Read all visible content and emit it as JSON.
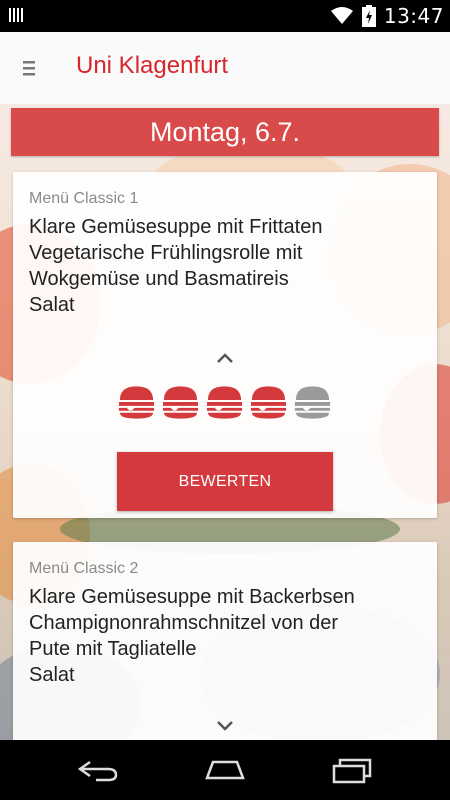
{
  "status_bar": {
    "time": "13:47",
    "icons": [
      "signal-bars-icon",
      "wifi-icon",
      "battery-icon"
    ]
  },
  "app_bar": {
    "title": "Uni Klagenfurt",
    "menu_icon": "hamburger-menu-icon"
  },
  "day_banner": {
    "label": "Montag, 6.7."
  },
  "menus": [
    {
      "label": "Menü Classic 1",
      "dishes": [
        "Klare Gemüsesuppe mit Frittaten",
        "Vegetarische Frühlingsrolle mit",
        "Wokgemüse und Basmatireis",
        "Salat"
      ],
      "rating": 4,
      "rating_max": 5,
      "rate_button": "BEWERTEN",
      "expanded": true
    },
    {
      "label": "Menü Classic 2",
      "dishes": [
        "Klare Gemüsesuppe mit Backerbsen",
        "Champignonrahmschnitzel von der",
        "Pute mit Tagliatelle",
        "Salat"
      ],
      "expanded": false
    }
  ],
  "colors": {
    "accent": "#d7262c",
    "banner": "#d94a4a",
    "button": "#d43a3d",
    "burger_active": "#d43a3d",
    "burger_inactive": "#9a9a9a"
  },
  "nav_bar": {
    "icons": [
      "back-icon",
      "home-icon",
      "recent-apps-icon"
    ]
  }
}
